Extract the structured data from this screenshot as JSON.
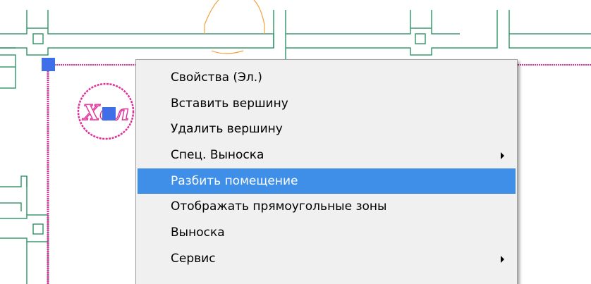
{
  "colors": {
    "wall_lines": "#3a9a6e",
    "room_boundary": "#e0309a",
    "grip": "#3f6fe8",
    "door_arc": "#f0a040",
    "menu_background": "#f0f0f0",
    "menu_highlight": "#3f8fe9"
  },
  "canvas": {
    "room_tag_text": "Хол"
  },
  "context_menu": {
    "items": [
      {
        "label": "Свойства (Эл.)",
        "has_submenu": false,
        "highlighted": false
      },
      {
        "label": "Вставить вершину",
        "has_submenu": false,
        "highlighted": false
      },
      {
        "label": "Удалить вершину",
        "has_submenu": false,
        "highlighted": false
      },
      {
        "label": "Спец. Выноска",
        "has_submenu": true,
        "highlighted": false
      },
      {
        "label": "Разбить помещение",
        "has_submenu": false,
        "highlighted": true
      },
      {
        "label": "Отображать прямоугольные зоны",
        "has_submenu": false,
        "highlighted": false
      },
      {
        "label": "Выноска",
        "has_submenu": false,
        "highlighted": false
      },
      {
        "label": "Сервис",
        "has_submenu": true,
        "highlighted": false
      }
    ]
  }
}
